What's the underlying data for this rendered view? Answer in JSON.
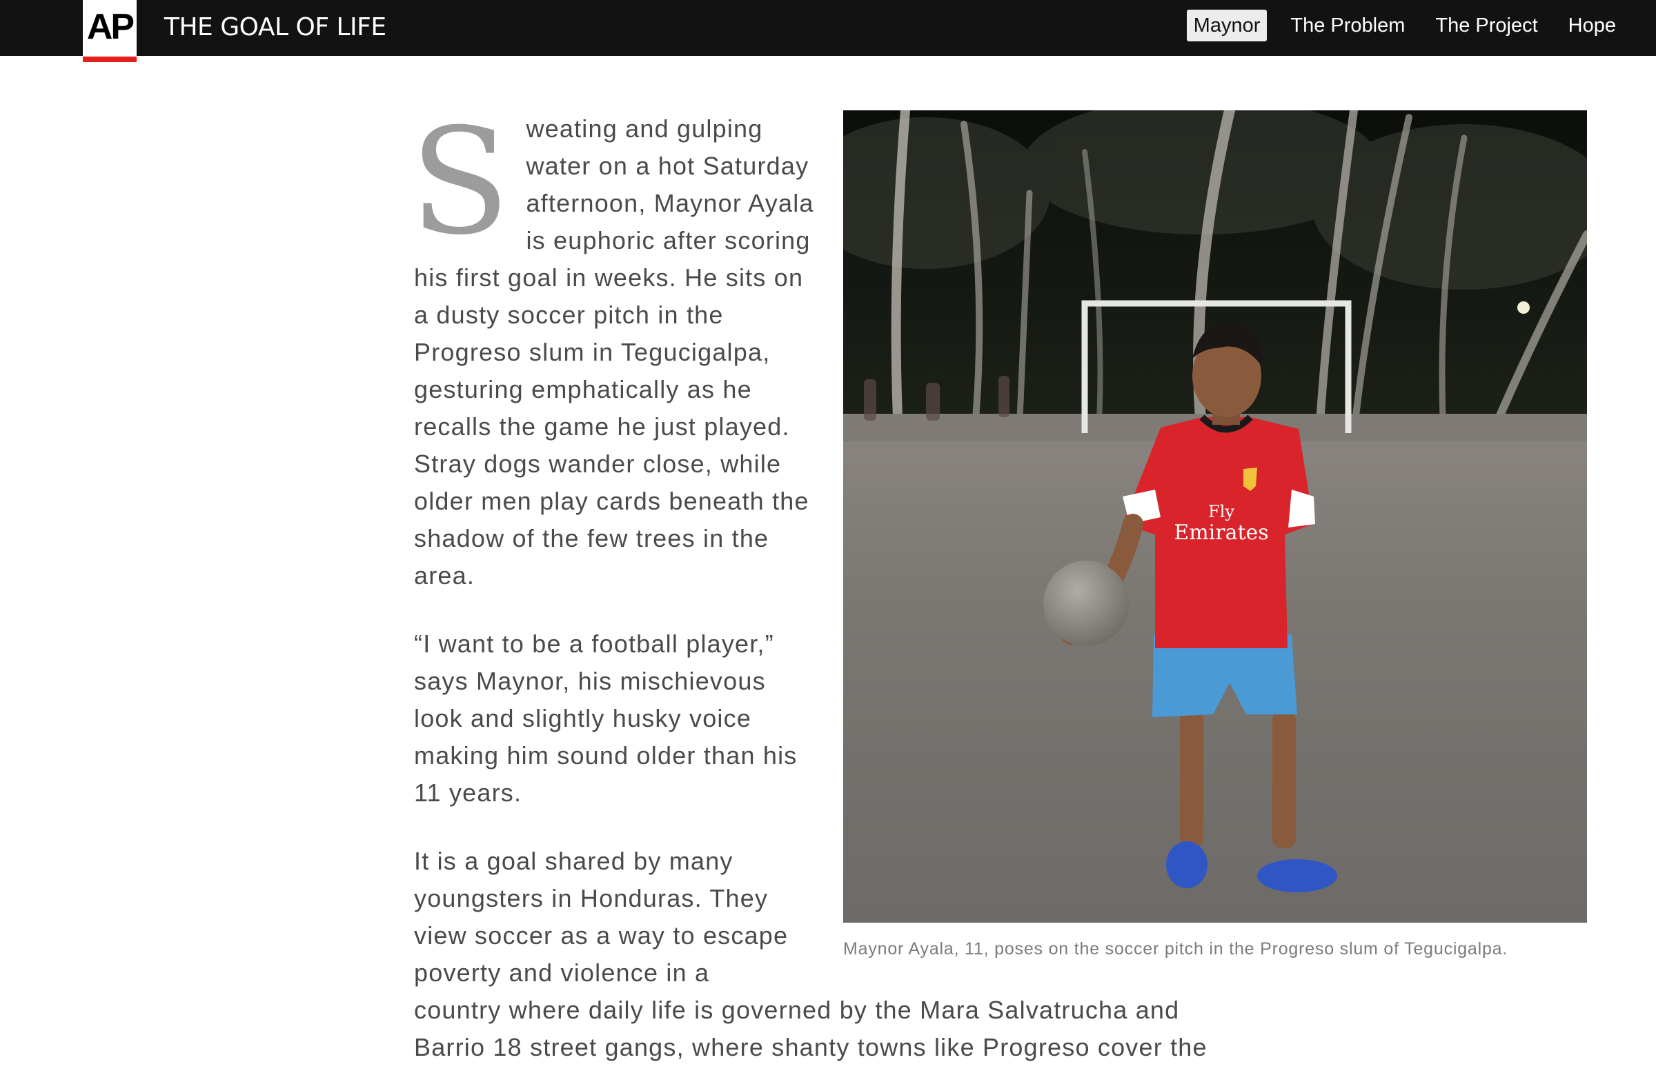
{
  "header": {
    "logo_text": "AP",
    "site_title": "THE GOAL OF LIFE",
    "nav": [
      {
        "label": "Maynor",
        "active": true
      },
      {
        "label": "The Problem",
        "active": false
      },
      {
        "label": "The Project",
        "active": false
      },
      {
        "label": "Hope",
        "active": false
      }
    ]
  },
  "article": {
    "dropcap": "S",
    "p1": "weating and gulping water on a hot Saturday afternoon, Maynor Ayala is euphoric after scoring his first goal in weeks. He sits on a dusty soccer pitch in the Progreso slum in Tegucigalpa, gesturing emphatically as he recalls the game he just played. Stray dogs wander close, while older men play cards beneath the shadow of the few trees in the area.",
    "p2": "“I want to be a football player,” says Maynor, his mischievous look and slightly husky voice making him sound older than his 11 years.",
    "p3_narrow": "It is a goal shared by many youngsters in Honduras. They view soccer as a way to escape poverty and violence in a",
    "p3_wide": "country where daily life is governed by the Mara Salvatrucha and Barrio 18 street gangs, where shanty towns like Progreso cover the"
  },
  "figure": {
    "shirt_text_line1": "Fly",
    "shirt_text_line2": "Emirates",
    "caption": "Maynor Ayala, 11, poses on the soccer pitch in the Progreso slum of Tegucigalpa."
  },
  "colors": {
    "topbar": "#121212",
    "accent": "#e3201b",
    "text": "#4a4a4a",
    "dropcap": "#9c9c9c",
    "caption": "#7b7b7b"
  }
}
